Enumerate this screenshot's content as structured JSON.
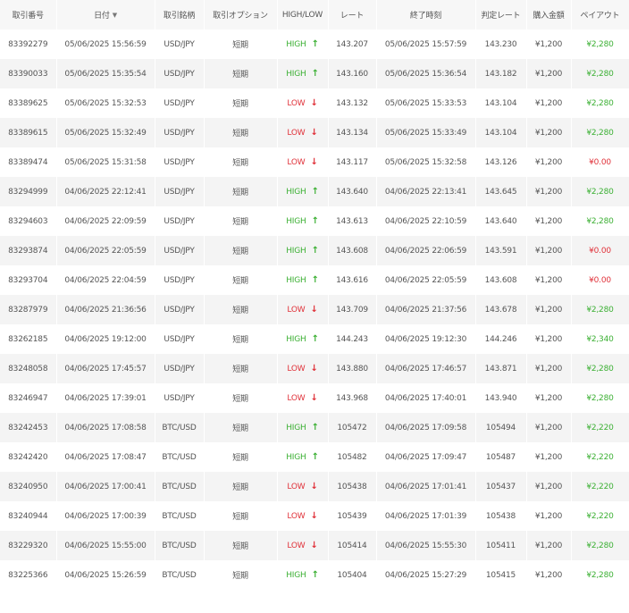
{
  "colors": {
    "high": "#3cb034",
    "low": "#e0323a",
    "payout_win": "#3cb034",
    "payout_lose": "#e0323a",
    "header_bg": "#f7f7f7",
    "stripe_bg": "#f4f4f4"
  },
  "table": {
    "headers": {
      "trade_id": "取引番号",
      "date": "日付",
      "date_sort_icon": "▼",
      "symbol": "取引銘柄",
      "option": "取引オプション",
      "direction": "HIGH/LOW",
      "rate": "レート",
      "end_time": "終了時刻",
      "judge_rate": "判定レート",
      "amount": "購入金額",
      "payout": "ペイアウト"
    },
    "rows": [
      {
        "id": "83392279",
        "date": "05/06/2025 15:56:59",
        "symbol": "USD/JPY",
        "option": "短期",
        "direction": "HIGH",
        "arrow": "↑",
        "dir_class": "dir-high",
        "rate": "143.207",
        "end": "05/06/2025 15:57:59",
        "judge": "143.230",
        "amount": "¥1,200",
        "payout": "¥2,280",
        "pay_class": "pay-win"
      },
      {
        "id": "83390033",
        "date": "05/06/2025 15:35:54",
        "symbol": "USD/JPY",
        "option": "短期",
        "direction": "HIGH",
        "arrow": "↑",
        "dir_class": "dir-high",
        "rate": "143.160",
        "end": "05/06/2025 15:36:54",
        "judge": "143.182",
        "amount": "¥1,200",
        "payout": "¥2,280",
        "pay_class": "pay-win"
      },
      {
        "id": "83389625",
        "date": "05/06/2025 15:32:53",
        "symbol": "USD/JPY",
        "option": "短期",
        "direction": "LOW",
        "arrow": "↓",
        "dir_class": "dir-low",
        "rate": "143.132",
        "end": "05/06/2025 15:33:53",
        "judge": "143.104",
        "amount": "¥1,200",
        "payout": "¥2,280",
        "pay_class": "pay-win"
      },
      {
        "id": "83389615",
        "date": "05/06/2025 15:32:49",
        "symbol": "USD/JPY",
        "option": "短期",
        "direction": "LOW",
        "arrow": "↓",
        "dir_class": "dir-low",
        "rate": "143.134",
        "end": "05/06/2025 15:33:49",
        "judge": "143.104",
        "amount": "¥1,200",
        "payout": "¥2,280",
        "pay_class": "pay-win"
      },
      {
        "id": "83389474",
        "date": "05/06/2025 15:31:58",
        "symbol": "USD/JPY",
        "option": "短期",
        "direction": "LOW",
        "arrow": "↓",
        "dir_class": "dir-low",
        "rate": "143.117",
        "end": "05/06/2025 15:32:58",
        "judge": "143.126",
        "amount": "¥1,200",
        "payout": "¥0.00",
        "pay_class": "pay-lose"
      },
      {
        "id": "83294999",
        "date": "04/06/2025 22:12:41",
        "symbol": "USD/JPY",
        "option": "短期",
        "direction": "HIGH",
        "arrow": "↑",
        "dir_class": "dir-high",
        "rate": "143.640",
        "end": "04/06/2025 22:13:41",
        "judge": "143.645",
        "amount": "¥1,200",
        "payout": "¥2,280",
        "pay_class": "pay-win"
      },
      {
        "id": "83294603",
        "date": "04/06/2025 22:09:59",
        "symbol": "USD/JPY",
        "option": "短期",
        "direction": "HIGH",
        "arrow": "↑",
        "dir_class": "dir-high",
        "rate": "143.613",
        "end": "04/06/2025 22:10:59",
        "judge": "143.640",
        "amount": "¥1,200",
        "payout": "¥2,280",
        "pay_class": "pay-win"
      },
      {
        "id": "83293874",
        "date": "04/06/2025 22:05:59",
        "symbol": "USD/JPY",
        "option": "短期",
        "direction": "HIGH",
        "arrow": "↑",
        "dir_class": "dir-high",
        "rate": "143.608",
        "end": "04/06/2025 22:06:59",
        "judge": "143.591",
        "amount": "¥1,200",
        "payout": "¥0.00",
        "pay_class": "pay-lose"
      },
      {
        "id": "83293704",
        "date": "04/06/2025 22:04:59",
        "symbol": "USD/JPY",
        "option": "短期",
        "direction": "HIGH",
        "arrow": "↑",
        "dir_class": "dir-high",
        "rate": "143.616",
        "end": "04/06/2025 22:05:59",
        "judge": "143.608",
        "amount": "¥1,200",
        "payout": "¥0.00",
        "pay_class": "pay-lose"
      },
      {
        "id": "83287979",
        "date": "04/06/2025 21:36:56",
        "symbol": "USD/JPY",
        "option": "短期",
        "direction": "LOW",
        "arrow": "↓",
        "dir_class": "dir-low",
        "rate": "143.709",
        "end": "04/06/2025 21:37:56",
        "judge": "143.678",
        "amount": "¥1,200",
        "payout": "¥2,280",
        "pay_class": "pay-win"
      },
      {
        "id": "83262185",
        "date": "04/06/2025 19:12:00",
        "symbol": "USD/JPY",
        "option": "短期",
        "direction": "HIGH",
        "arrow": "↑",
        "dir_class": "dir-high",
        "rate": "144.243",
        "end": "04/06/2025 19:12:30",
        "judge": "144.246",
        "amount": "¥1,200",
        "payout": "¥2,340",
        "pay_class": "pay-win"
      },
      {
        "id": "83248058",
        "date": "04/06/2025 17:45:57",
        "symbol": "USD/JPY",
        "option": "短期",
        "direction": "LOW",
        "arrow": "↓",
        "dir_class": "dir-low",
        "rate": "143.880",
        "end": "04/06/2025 17:46:57",
        "judge": "143.871",
        "amount": "¥1,200",
        "payout": "¥2,280",
        "pay_class": "pay-win"
      },
      {
        "id": "83246947",
        "date": "04/06/2025 17:39:01",
        "symbol": "USD/JPY",
        "option": "短期",
        "direction": "LOW",
        "arrow": "↓",
        "dir_class": "dir-low",
        "rate": "143.968",
        "end": "04/06/2025 17:40:01",
        "judge": "143.940",
        "amount": "¥1,200",
        "payout": "¥2,280",
        "pay_class": "pay-win"
      },
      {
        "id": "83242453",
        "date": "04/06/2025 17:08:58",
        "symbol": "BTC/USD",
        "option": "短期",
        "direction": "HIGH",
        "arrow": "↑",
        "dir_class": "dir-high",
        "rate": "105472",
        "end": "04/06/2025 17:09:58",
        "judge": "105494",
        "amount": "¥1,200",
        "payout": "¥2,220",
        "pay_class": "pay-win"
      },
      {
        "id": "83242420",
        "date": "04/06/2025 17:08:47",
        "symbol": "BTC/USD",
        "option": "短期",
        "direction": "HIGH",
        "arrow": "↑",
        "dir_class": "dir-high",
        "rate": "105482",
        "end": "04/06/2025 17:09:47",
        "judge": "105487",
        "amount": "¥1,200",
        "payout": "¥2,220",
        "pay_class": "pay-win"
      },
      {
        "id": "83240950",
        "date": "04/06/2025 17:00:41",
        "symbol": "BTC/USD",
        "option": "短期",
        "direction": "LOW",
        "arrow": "↓",
        "dir_class": "dir-low",
        "rate": "105438",
        "end": "04/06/2025 17:01:41",
        "judge": "105437",
        "amount": "¥1,200",
        "payout": "¥2,220",
        "pay_class": "pay-win"
      },
      {
        "id": "83240944",
        "date": "04/06/2025 17:00:39",
        "symbol": "BTC/USD",
        "option": "短期",
        "direction": "LOW",
        "arrow": "↓",
        "dir_class": "dir-low",
        "rate": "105439",
        "end": "04/06/2025 17:01:39",
        "judge": "105438",
        "amount": "¥1,200",
        "payout": "¥2,220",
        "pay_class": "pay-win"
      },
      {
        "id": "83229320",
        "date": "04/06/2025 15:55:00",
        "symbol": "BTC/USD",
        "option": "短期",
        "direction": "LOW",
        "arrow": "↓",
        "dir_class": "dir-low",
        "rate": "105414",
        "end": "04/06/2025 15:55:30",
        "judge": "105411",
        "amount": "¥1,200",
        "payout": "¥2,280",
        "pay_class": "pay-win"
      },
      {
        "id": "83225366",
        "date": "04/06/2025 15:26:59",
        "symbol": "BTC/USD",
        "option": "短期",
        "direction": "HIGH",
        "arrow": "↑",
        "dir_class": "dir-high",
        "rate": "105404",
        "end": "04/06/2025 15:27:29",
        "judge": "105415",
        "amount": "¥1,200",
        "payout": "¥2,280",
        "pay_class": "pay-win"
      }
    ]
  }
}
